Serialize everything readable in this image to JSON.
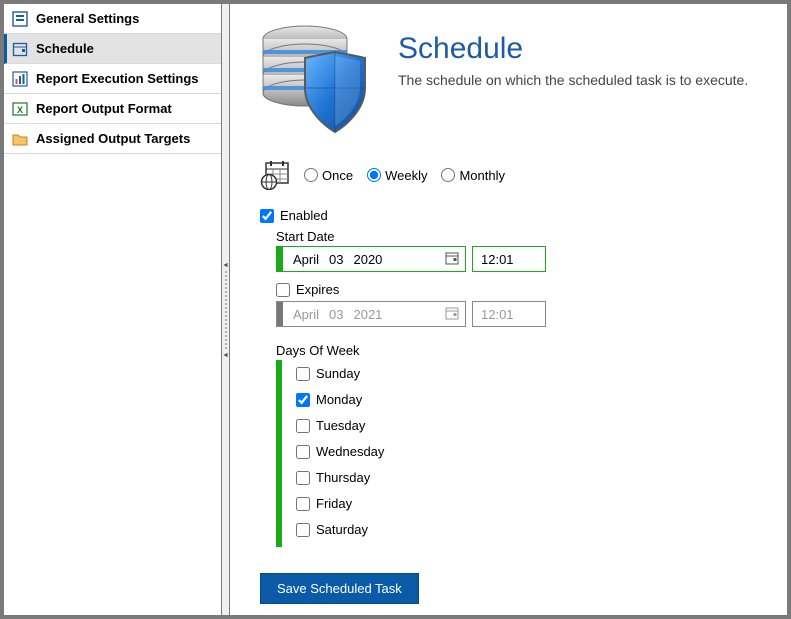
{
  "sidebar": {
    "items": [
      {
        "label": "General Settings"
      },
      {
        "label": "Schedule"
      },
      {
        "label": "Report Execution Settings"
      },
      {
        "label": "Report Output Format"
      },
      {
        "label": "Assigned Output Targets"
      }
    ],
    "selected_index": 1
  },
  "header": {
    "title": "Schedule",
    "subtitle": "The schedule on which the scheduled task is to execute."
  },
  "frequency": {
    "options": [
      "Once",
      "Weekly",
      "Monthly"
    ],
    "selected": "Weekly"
  },
  "enabled": {
    "label": "Enabled",
    "checked": true
  },
  "start_date": {
    "label": "Start Date",
    "month": "April",
    "day": "03",
    "year": "2020",
    "time": "12:01"
  },
  "expires": {
    "label": "Expires",
    "checked": false,
    "month": "April",
    "day": "03",
    "year": "2021",
    "time": "12:01"
  },
  "days_of_week": {
    "label": "Days Of Week",
    "items": [
      {
        "label": "Sunday",
        "checked": false
      },
      {
        "label": "Monday",
        "checked": true
      },
      {
        "label": "Tuesday",
        "checked": false
      },
      {
        "label": "Wednesday",
        "checked": false
      },
      {
        "label": "Thursday",
        "checked": false
      },
      {
        "label": "Friday",
        "checked": false
      },
      {
        "label": "Saturday",
        "checked": false
      }
    ]
  },
  "save_button": "Save Scheduled Task"
}
